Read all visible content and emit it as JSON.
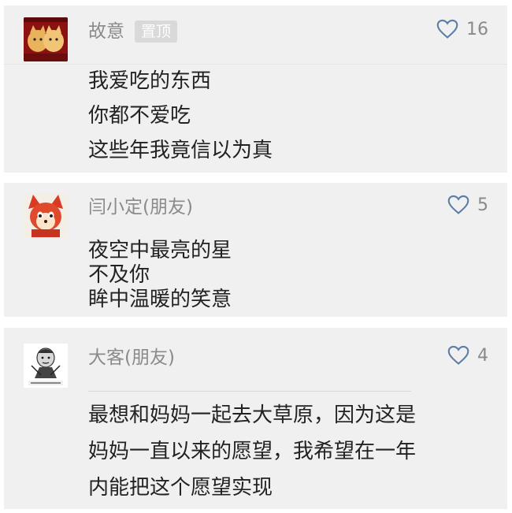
{
  "comments": [
    {
      "username": "故意",
      "badge": "置顶",
      "likes": "16",
      "avatar": "cats-photo-icon",
      "lines": [
        "我爱吃的东西",
        "你都不爱吃",
        "这些年我竟信以为真"
      ]
    },
    {
      "username": "闫小定(朋友)",
      "likes": "5",
      "avatar": "red-fox-cartoon-icon",
      "lines": [
        "夜空中最亮的星",
        "不及你",
        "眸中温暖的笑意"
      ]
    },
    {
      "username": "大客(朋友)",
      "likes": "4",
      "avatar": "meme-face-icon",
      "lines": [
        "最想和妈妈一起去大草原，因为这是",
        "妈妈一直以来的愿望，我希望在一年",
        "内能把这个愿望实现"
      ]
    }
  ],
  "colors": {
    "card_bg": "#f0f0f0",
    "username": "#8a8a8a",
    "body_text": "#222222",
    "badge_bg": "#d9d9d9"
  }
}
